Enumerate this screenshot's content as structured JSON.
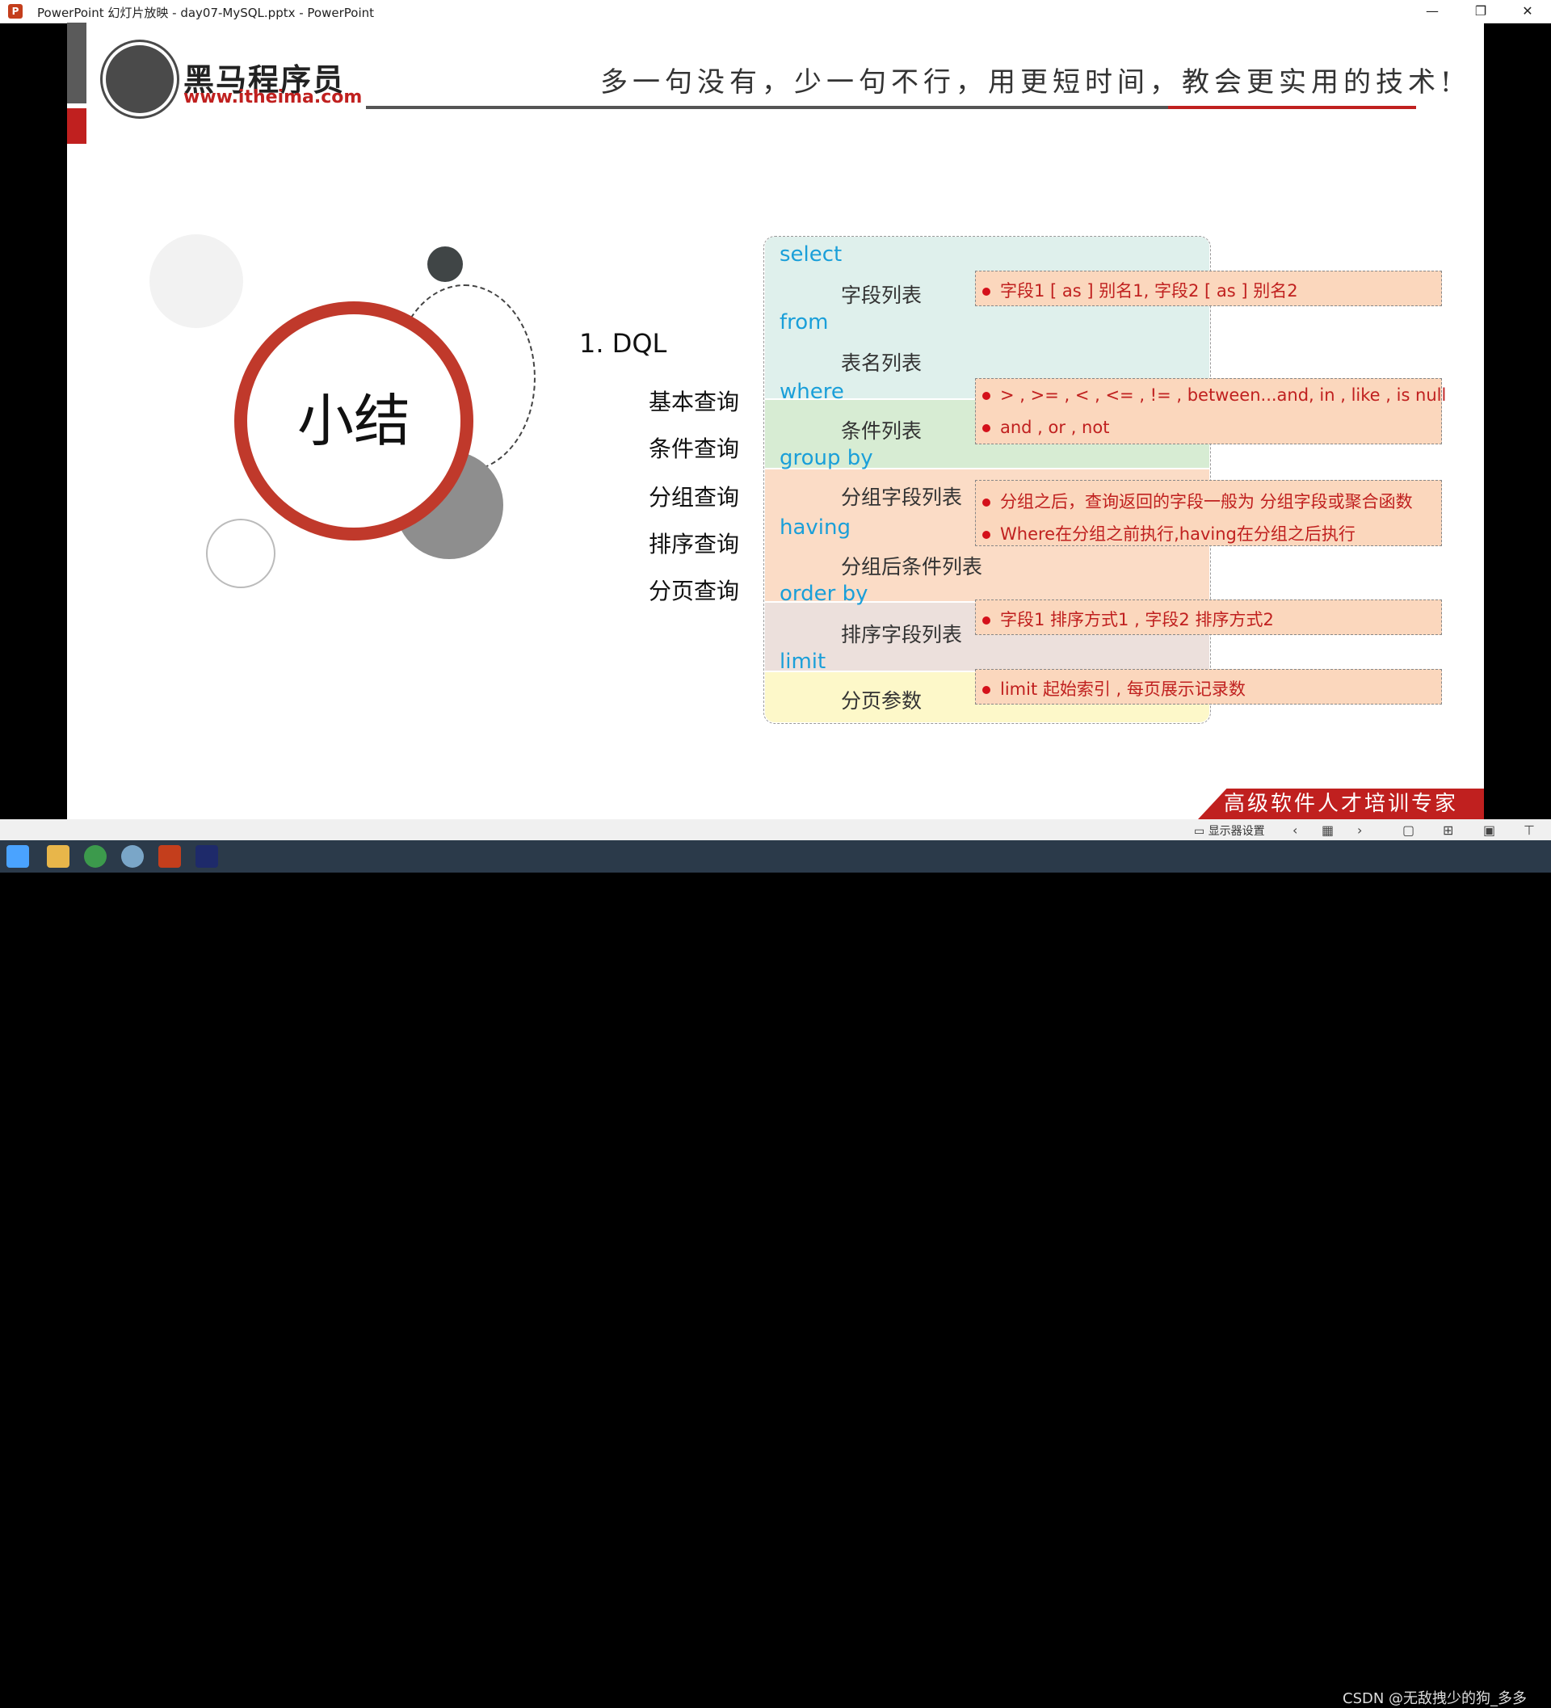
{
  "window": {
    "title": "PowerPoint 幻灯片放映  -  day07-MySQL.pptx - PowerPoint",
    "app_icon": "P",
    "minimize": "—",
    "restore": "❐",
    "close": "✕"
  },
  "header": {
    "logo_cn": "黑马程序员",
    "logo_url": "www.itheima.com",
    "slogan": "多一句没有，少一句不行，用更短时间，教会更实用的技术!"
  },
  "slide": {
    "title": "小结",
    "section": "1.  DQL",
    "categories": [
      "基本查询",
      "条件查询",
      "分组查询",
      "排序查询",
      "分页查询"
    ],
    "syntax": {
      "select_kw": "select",
      "select_sub": "字段列表",
      "from_kw": "from",
      "from_sub": "表名列表",
      "where_kw": "where",
      "where_sub": "条件列表",
      "group_kw": "group  by",
      "group_sub": "分组字段列表",
      "having_kw": "having",
      "having_sub": "分组后条件列表",
      "order_kw": "order by",
      "order_sub": "排序字段列表",
      "limit_kw": "limit",
      "limit_sub": "分页参数"
    },
    "notes": {
      "select": "字段1 [ as ] 别名1, 字段2 [ as ] 别名2",
      "where_1": "> , >= , < , <= , != , between...and, in , like , is null",
      "where_2": "and , or  , not",
      "group_1": "分组之后，查询返回的字段一般为 分组字段或聚合函数",
      "group_2": "Where在分组之前执行,having在分组之后执行",
      "order": "字段1  排序方式1 , 字段2  排序方式2",
      "limit": "limit  起始索引 , 每页展示记录数"
    },
    "banner": "高级软件人才培训专家"
  },
  "statusbar": {
    "display_settings": "显示器设置"
  },
  "watermark": "CSDN @无敌拽少的狗_多多",
  "colors": {
    "red": "#c0201f",
    "keyword_blue": "#1a9fd9",
    "select_bg": "#dff0ec",
    "where_bg": "#d7ecd3",
    "group_bg": "#fbdcc6",
    "order_bg": "#ece0dc",
    "limit_bg": "#fdf8c9",
    "note_bg": "#fbd7bd"
  }
}
